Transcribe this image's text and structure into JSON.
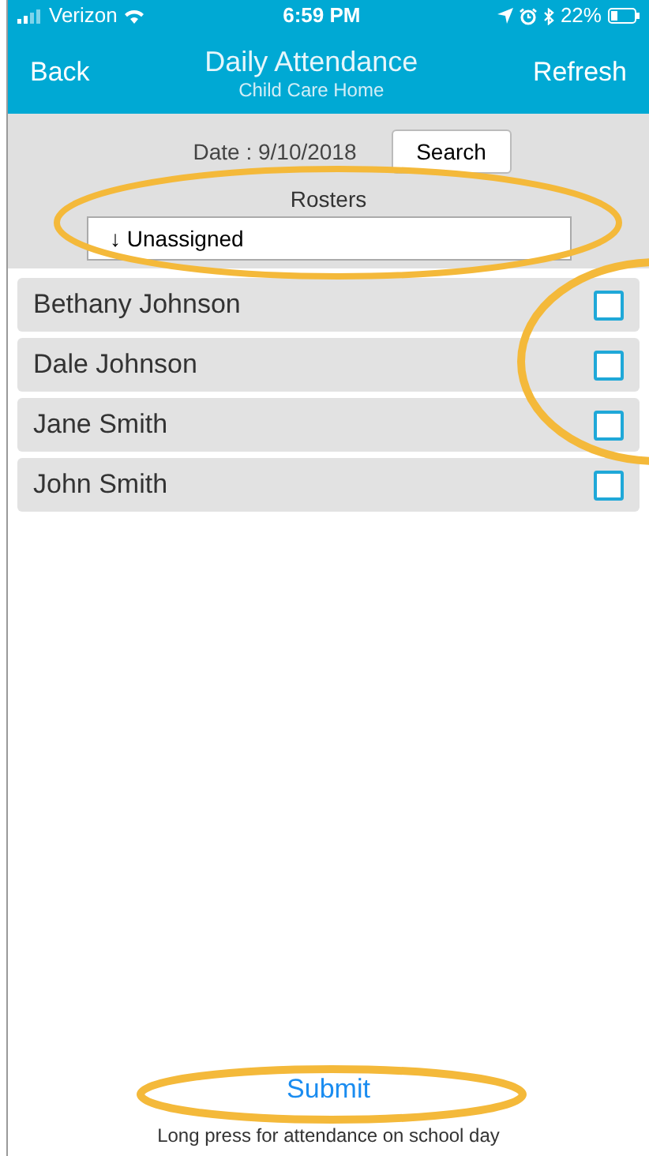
{
  "status_bar": {
    "carrier": "Verizon",
    "time": "6:59 PM",
    "battery": "22%"
  },
  "nav": {
    "back": "Back",
    "title": "Daily Attendance",
    "subtitle": "Child Care Home",
    "refresh": "Refresh"
  },
  "filter": {
    "date": "Date : 9/10/2018",
    "search": "Search",
    "rosters_label": "Rosters",
    "roster_value": "↓ Unassigned"
  },
  "children": [
    {
      "name": "Bethany Johnson",
      "checked": false
    },
    {
      "name": "Dale Johnson",
      "checked": false
    },
    {
      "name": "Jane Smith",
      "checked": false
    },
    {
      "name": "John Smith",
      "checked": false
    }
  ],
  "submit": "Submit",
  "hint": "Long press for attendance on school day"
}
